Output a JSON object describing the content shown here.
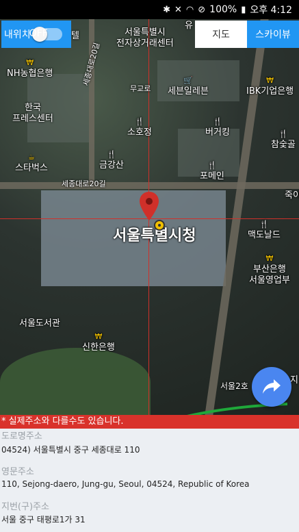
{
  "status_bar": {
    "icons": [
      "bluetooth-icon",
      "mute-icon",
      "wifi-icon",
      "dnd-icon"
    ],
    "battery": "100%",
    "time": "오후 4:12"
  },
  "controls": {
    "my_location_label": "내위치",
    "toggle_state": "OFF",
    "map_button": "지도",
    "skyview_button": "스카이뷰"
  },
  "map": {
    "pois": [
      {
        "name": "텔"
      },
      {
        "name": "서울특별시\n전자상거래센터"
      },
      {
        "name": "유"
      },
      {
        "name": "NH농협은행"
      },
      {
        "name": "무교로"
      },
      {
        "name": "세븐일레븐"
      },
      {
        "name": "IBK기업은행"
      },
      {
        "name": "세종대로20길"
      },
      {
        "name": "한국\n프레스센터"
      },
      {
        "name": "소호정"
      },
      {
        "name": "버거킹"
      },
      {
        "name": "참숯골"
      },
      {
        "name": "스타벅스"
      },
      {
        "name": "금강산"
      },
      {
        "name": "포메인"
      },
      {
        "name": "세종대로20길"
      },
      {
        "name": "죽이"
      },
      {
        "name": "맥도날드"
      },
      {
        "name": "부산은행\n서울영업부"
      },
      {
        "name": "서울도서관"
      },
      {
        "name": "신한은행"
      },
      {
        "name": "서울2호"
      },
      {
        "name": "지"
      }
    ],
    "center_label": "서울특별시청"
  },
  "warning": "* 실제주소와 다를수도 있습니다.",
  "address": {
    "road_label": "도로명주소",
    "road_value": "04524) 서울특별시 중구 세종대로 110",
    "english_label": "영문주소",
    "english_value": "110, Sejong-daero, Jung-gu, Seoul, 04524, Republic of Korea",
    "jibun_label": "지번(구)주소",
    "jibun_value": "서울 중구 태평로1가 31"
  }
}
